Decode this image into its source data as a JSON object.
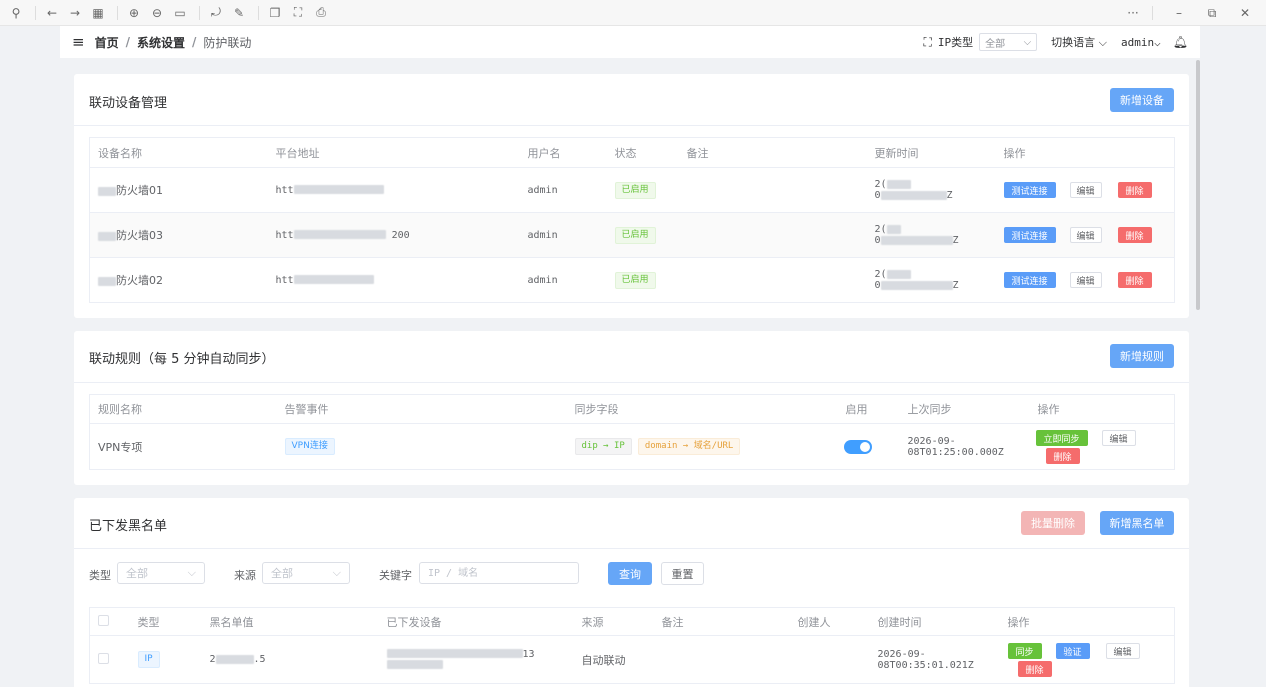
{
  "header": {
    "breadcrumb": [
      "首页",
      "系统设置",
      "防护联动"
    ],
    "ip_type_label": "IP类型",
    "ip_type_value": "全部",
    "language_label": "切换语言",
    "user_label": "admin"
  },
  "devices": {
    "title": "联动设备管理",
    "add_button": "新增设备",
    "columns": [
      "设备名称",
      "平台地址",
      "用户名",
      "状态",
      "备注",
      "更新时间",
      "操作"
    ],
    "rows": [
      {
        "name_suffix": "防火墙01",
        "addr_prefix": "htt",
        "addr_suffix": "",
        "user": "admin",
        "status": "已启用",
        "time_a": "2(",
        "time_b": "0",
        "time_end": "Z"
      },
      {
        "name_suffix": "防火墙03",
        "addr_prefix": "htt",
        "addr_suffix": "200",
        "user": "admin",
        "status": "已启用",
        "time_a": "2(",
        "time_b": "0",
        "time_end": "Z"
      },
      {
        "name_suffix": "防火墙02",
        "addr_prefix": "htt",
        "addr_suffix": "",
        "user": "admin",
        "status": "已启用",
        "time_a": "2(",
        "time_b": "0",
        "time_end": "Z"
      }
    ],
    "actions": {
      "test": "测试连接",
      "edit": "编辑",
      "delete": "删除"
    }
  },
  "rules": {
    "title": "联动规则（每 5 分钟自动同步）",
    "add_button": "新增规则",
    "columns": [
      "规则名称",
      "告警事件",
      "同步字段",
      "启用",
      "上次同步",
      "操作"
    ],
    "rows": [
      {
        "name": "VPN专项",
        "event": "VPN连接",
        "field1": "dip → IP",
        "field2": "domain → 域名/URL",
        "enabled": true,
        "last_sync_a": "2026-09-",
        "last_sync_b": "08T01:25:00.000Z"
      }
    ],
    "actions": {
      "sync": "立即同步",
      "edit": "编辑",
      "delete": "删除"
    }
  },
  "blacklist": {
    "title": "已下发黑名单",
    "batch_delete": "批量删除",
    "add_button": "新增黑名单",
    "filter": {
      "type_label": "类型",
      "type_value": "全部",
      "source_label": "来源",
      "source_value": "全部",
      "keyword_label": "关键字",
      "keyword_placeholder": "IP / 域名",
      "query": "查询",
      "reset": "重置"
    },
    "columns": [
      "类型",
      "黑名单值",
      "已下发设备",
      "来源",
      "备注",
      "创建人",
      "创建时间",
      "操作"
    ],
    "rows": [
      {
        "type": "IP",
        "value_prefix": "2",
        "value_suffix": ".5",
        "device_suffix": "13",
        "source": "自动联动",
        "time_a": "2026-09-",
        "time_b": "08T00:35:01.021Z"
      }
    ],
    "actions": {
      "sync": "同步",
      "verify": "验证",
      "edit": "编辑",
      "delete": "删除"
    }
  },
  "colors": {
    "primary": "#409eff",
    "danger": "#f56c6c",
    "success": "#67c23a"
  }
}
